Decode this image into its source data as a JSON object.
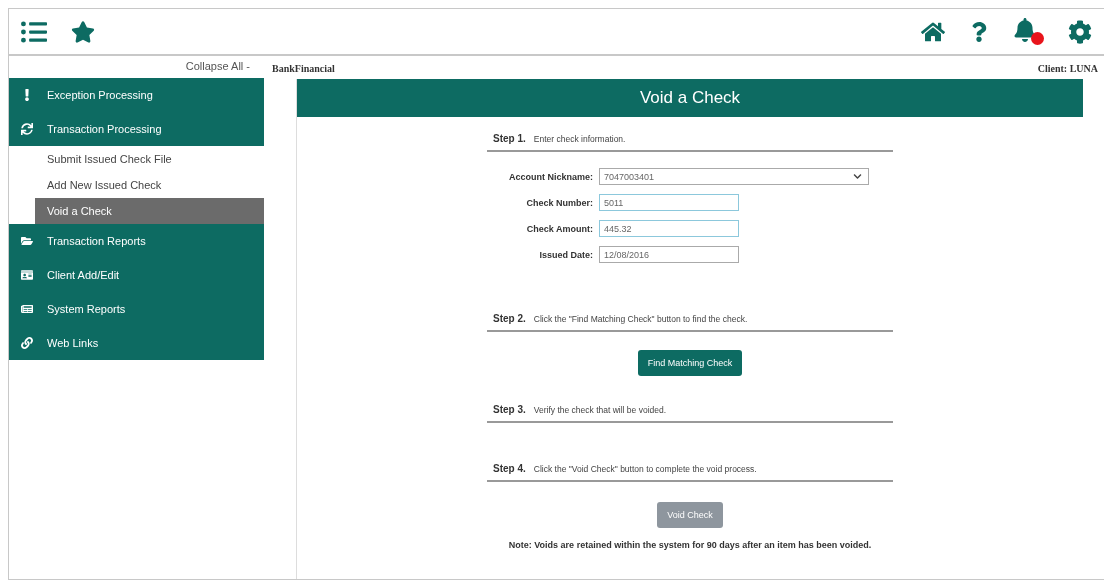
{
  "toolbar": {
    "bell_alert": true
  },
  "sidebar": {
    "collapse_label": "Collapse All -",
    "items": [
      {
        "label": "Exception Processing"
      },
      {
        "label": "Transaction Processing",
        "expanded": true,
        "children": [
          {
            "label": "Submit Issued Check File",
            "selected": false
          },
          {
            "label": "Add New Issued Check",
            "selected": false
          },
          {
            "label": "Void a Check",
            "selected": true
          }
        ]
      },
      {
        "label": "Transaction Reports"
      },
      {
        "label": "Client Add/Edit"
      },
      {
        "label": "System Reports"
      },
      {
        "label": "Web Links"
      }
    ]
  },
  "header": {
    "bank": "BankFinancial",
    "client": "Client: LUNA"
  },
  "panel": {
    "title": "Void a Check",
    "steps": [
      {
        "step": "Step 1.",
        "text": "Enter check information."
      },
      {
        "step": "Step 2.",
        "text": "Click the \"Find Matching Check\" button to find the check."
      },
      {
        "step": "Step 3.",
        "text": "Verify the check that will be voided."
      },
      {
        "step": "Step 4.",
        "text": "Click the \"Void Check\" button to complete the void process."
      }
    ],
    "fields": [
      {
        "kind": "select",
        "label": "Account Nickname:",
        "value": "7047003401",
        "highlighted": false
      },
      {
        "kind": "text",
        "label": "Check Number:",
        "value": "5011",
        "highlighted": true
      },
      {
        "kind": "text",
        "label": "Check Amount:",
        "value": "445.32",
        "highlighted": true
      },
      {
        "kind": "text",
        "label": "Issued Date:",
        "value": "12/08/2016",
        "highlighted": false
      }
    ],
    "find_button": {
      "label": "Find Matching Check",
      "disabled": false
    },
    "void_button": {
      "label": "Void Check",
      "disabled": true
    },
    "note": "Note: Voids are retained within the system for 90 days after an item has been voided."
  }
}
